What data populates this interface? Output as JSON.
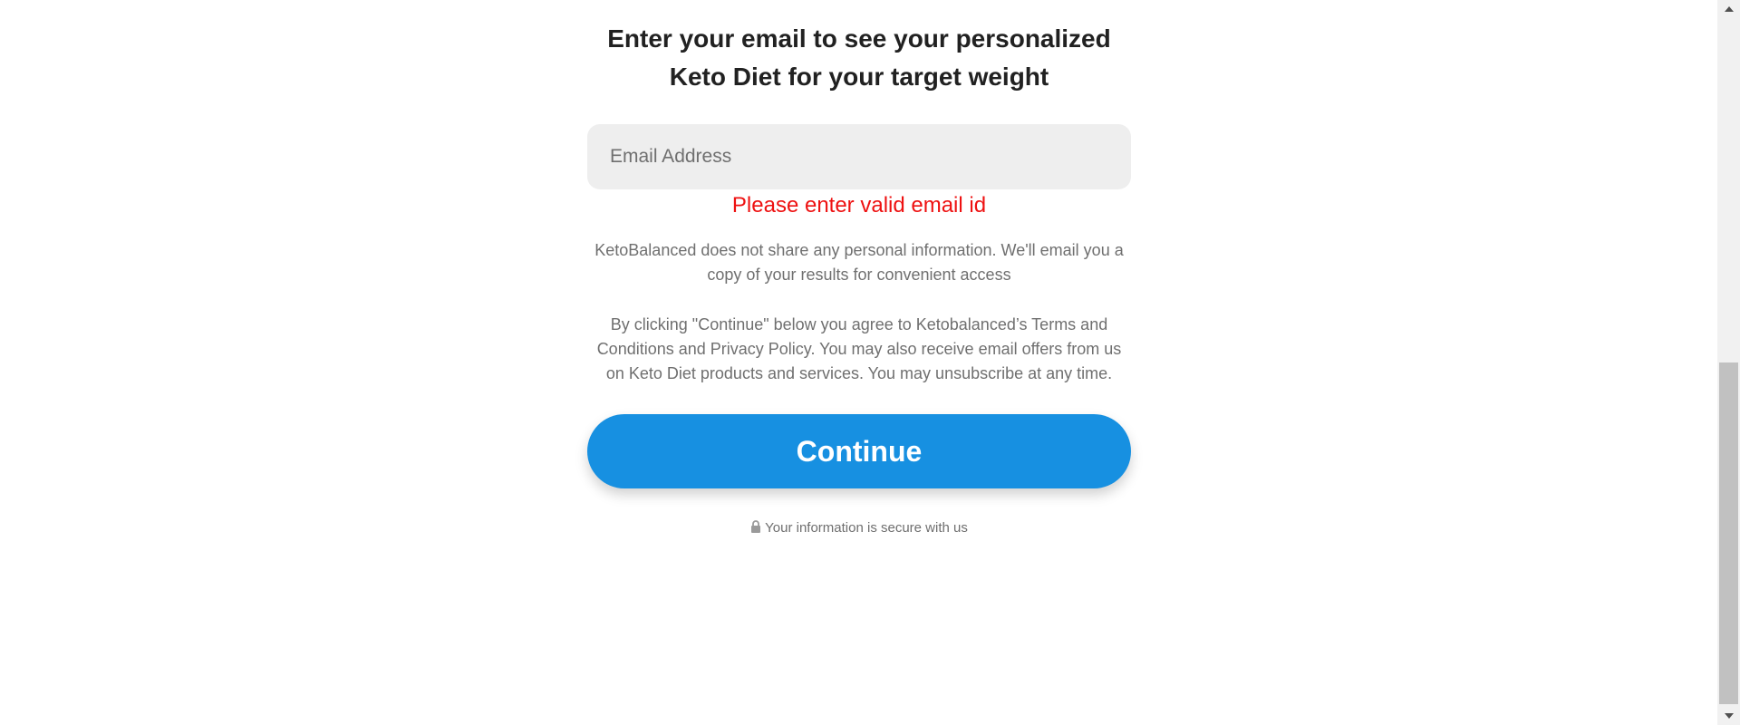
{
  "heading": {
    "line1": "Enter your email to see your personalized",
    "line2": "Keto Diet for your target weight"
  },
  "email_field": {
    "placeholder": "Email Address",
    "value": ""
  },
  "error_message": "Please enter valid email id",
  "privacy_notice": "KetoBalanced does not share any personal information. We'll email you a copy of your results for convenient access",
  "terms_notice": "By clicking \"Continue\" below you agree to Ketobalanced’s Terms and Conditions and Privacy Policy. You may also receive email offers from us on Keto Diet products and services. You may unsubscribe at any time.",
  "continue_button": {
    "label": "Continue"
  },
  "secure_note": {
    "icon": "lock-icon",
    "text": "Your information is secure with us"
  },
  "colors": {
    "button": "#1790e1",
    "error": "#ee1111",
    "input_bg": "#eeeeee"
  }
}
